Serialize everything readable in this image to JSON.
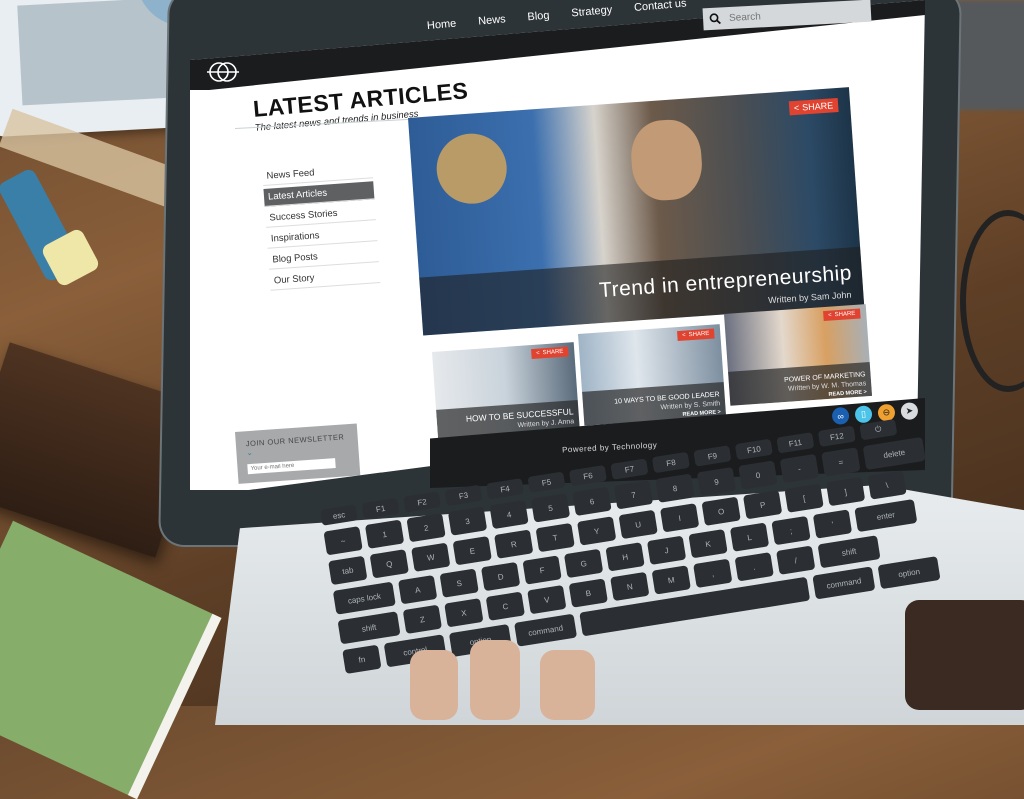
{
  "site": {
    "nav": [
      "Home",
      "News",
      "Blog",
      "Strategy",
      "Contact us"
    ],
    "search_placeholder": "Search",
    "logo": "logo-icon"
  },
  "header": {
    "title": "LATEST ARTICLES",
    "subtitle": "The latest news and trends in business"
  },
  "sidebar": {
    "items": [
      {
        "label": "News Feed",
        "active": false
      },
      {
        "label": "Latest Articles",
        "active": true
      },
      {
        "label": "Success Stories",
        "active": false
      },
      {
        "label": "Inspirations",
        "active": false
      },
      {
        "label": "Blog Posts",
        "active": false
      },
      {
        "label": "Our Story",
        "active": false
      }
    ]
  },
  "hero": {
    "title": "Trend in entrepreneurship",
    "author": "Written by Sam John",
    "share_label": "SHARE"
  },
  "cards": [
    {
      "title": "HOW TO BE SUCCESSFUL",
      "author": "Written by J. Anna",
      "read_more": "READ MORE >",
      "share_label": "SHARE"
    },
    {
      "title": "10 WAYS TO BE GOOD LEADER",
      "author": "Written by S. Smith",
      "read_more": "READ MORE >",
      "share_label": "SHARE"
    },
    {
      "title": "POWER OF MARKETING",
      "author": "Written by W. M. Thomas",
      "read_more": "READ MORE >",
      "share_label": "SHARE"
    }
  ],
  "social": [
    {
      "icon": "link-icon",
      "color": "#1b5fb0"
    },
    {
      "icon": "bookmark-icon",
      "color": "#4cc3e8"
    },
    {
      "icon": "blogger-icon",
      "color": "#f0a02e"
    },
    {
      "icon": "send-icon",
      "color": "#d9dcde"
    }
  ],
  "newsletter": {
    "label": "JOIN OUR NEWSLETTER",
    "placeholder": "Your e-mail here"
  },
  "footer": {
    "text": "Powered by Technology"
  },
  "colors": {
    "accent": "#e04431",
    "nav_bg": "#1b1c1e",
    "active_item": "#5e6062"
  },
  "keyboard": {
    "rows": [
      [
        "esc",
        "F1",
        "F2",
        "F3",
        "F4",
        "F5",
        "F6",
        "F7",
        "F8",
        "F9",
        "F10",
        "F11",
        "F12",
        "⏻"
      ],
      [
        "~",
        "1",
        "2",
        "3",
        "4",
        "5",
        "6",
        "7",
        "8",
        "9",
        "0",
        "-",
        "=",
        "delete"
      ],
      [
        "tab",
        "Q",
        "W",
        "E",
        "R",
        "T",
        "Y",
        "U",
        "I",
        "O",
        "P",
        "[",
        "]",
        "\\"
      ],
      [
        "caps lock",
        "A",
        "S",
        "D",
        "F",
        "G",
        "H",
        "J",
        "K",
        "L",
        ";",
        "'",
        "enter"
      ],
      [
        "shift",
        "Z",
        "X",
        "C",
        "V",
        "B",
        "N",
        "M",
        ",",
        ".",
        "/",
        "shift"
      ],
      [
        "fn",
        "control",
        "option",
        "command",
        "",
        "command",
        "option"
      ]
    ]
  }
}
